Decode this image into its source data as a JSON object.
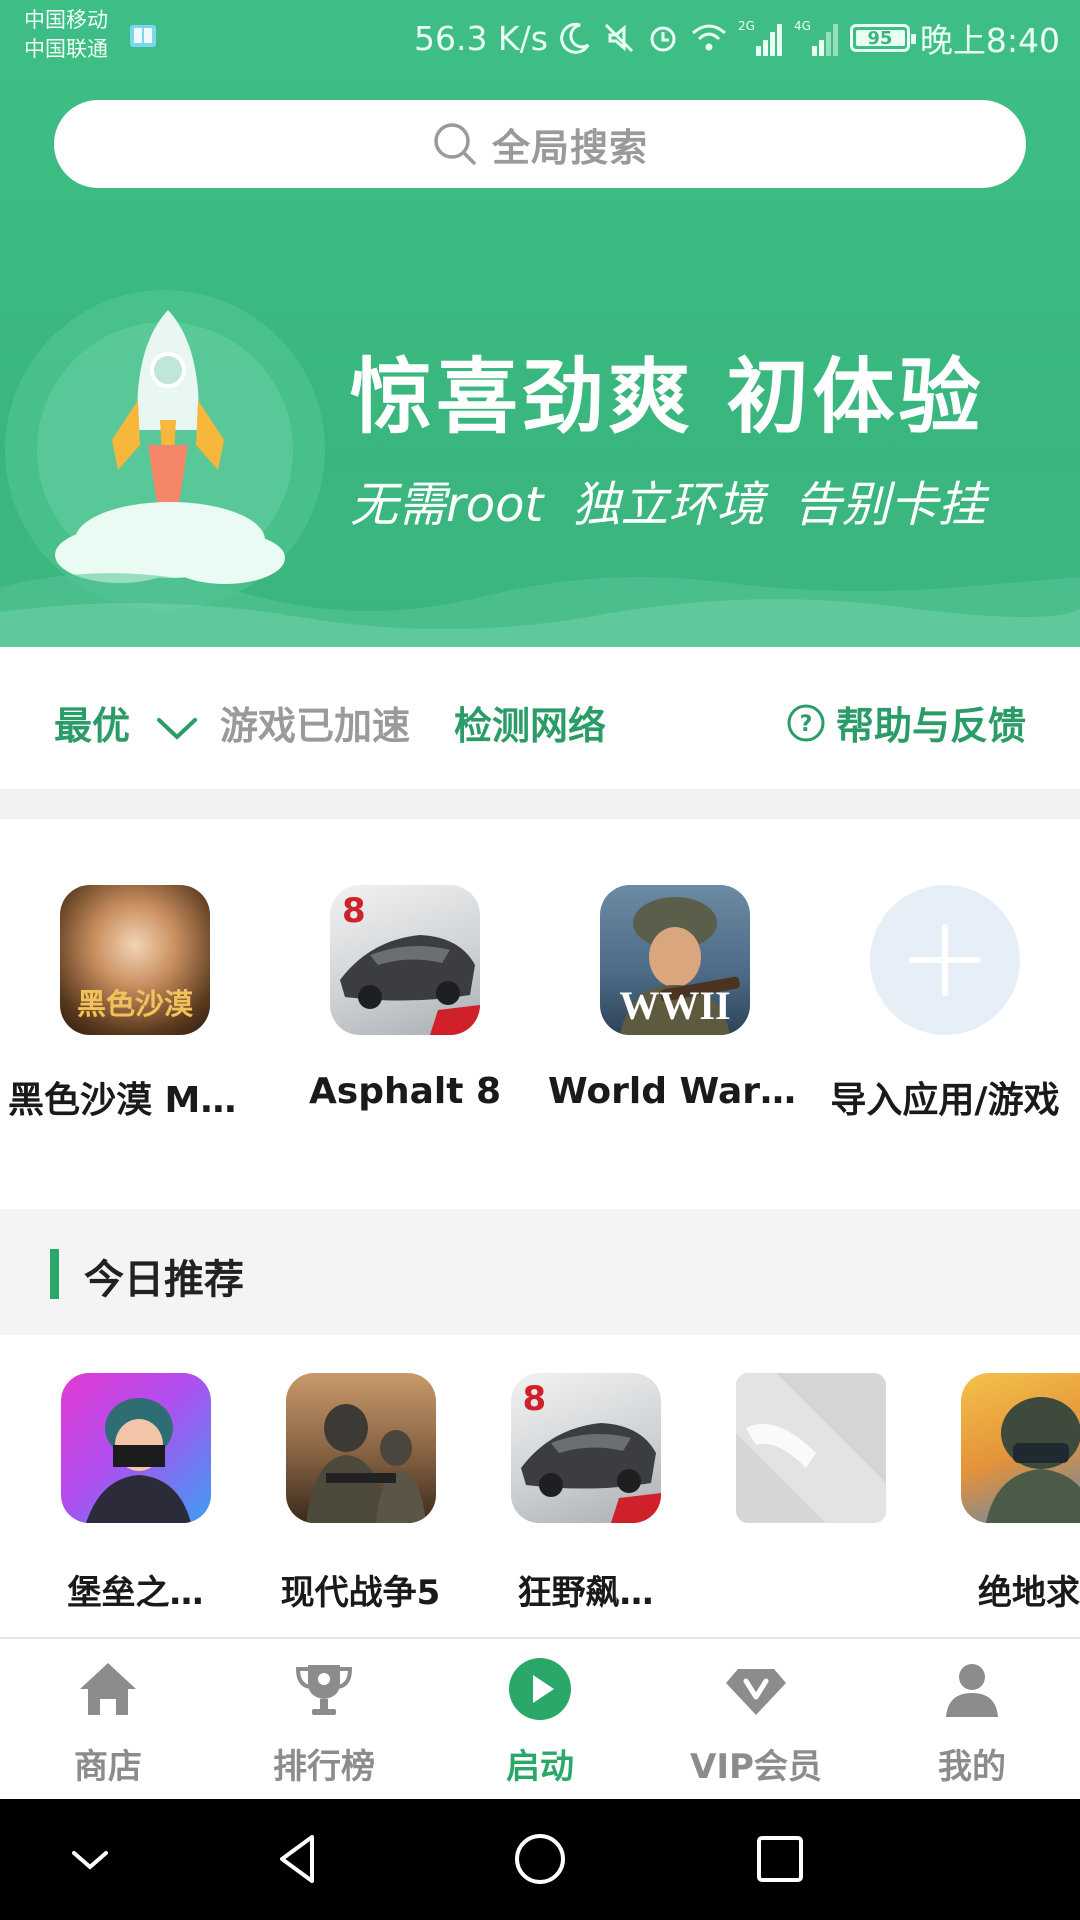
{
  "status_bar": {
    "carrier1": "中国移动",
    "carrier2": "中国联通",
    "speed": "56.3 K/s",
    "net1": "2G",
    "net2": "4G",
    "battery": "95",
    "time": "晚上8:40"
  },
  "search": {
    "placeholder": "全局搜索"
  },
  "banner": {
    "title": "惊喜劲爽  初体验",
    "subtitle": "无需root  独立环境  告别卡挂"
  },
  "accelerate": {
    "mode": "最优",
    "status": "游戏已加速",
    "detect": "检测网络",
    "help": "帮助与反馈"
  },
  "my_games": [
    {
      "name": "黑色沙漠 MO…",
      "icon_text": "黑色沙漠"
    },
    {
      "name": "Asphalt 8",
      "icon_text": "8"
    },
    {
      "name": "World War …",
      "icon_text": "WWII"
    },
    {
      "name": "导入应用/游戏"
    }
  ],
  "recommend": {
    "title": "今日推荐",
    "items": [
      {
        "name": "堡垒之…"
      },
      {
        "name": "现代战争5"
      },
      {
        "name": "狂野飙…"
      },
      {
        "name": ""
      },
      {
        "name": "绝地求·"
      }
    ]
  },
  "nav": {
    "items": [
      {
        "label": "商店",
        "icon": "home-icon"
      },
      {
        "label": "排行榜",
        "icon": "trophy-icon"
      },
      {
        "label": "启动",
        "icon": "play-icon"
      },
      {
        "label": "VIP会员",
        "icon": "vip-diamond-icon"
      },
      {
        "label": "我的",
        "icon": "user-icon"
      }
    ],
    "active": "启动"
  },
  "colors": {
    "brand": "#3ab57d",
    "accent_text": "#2b9c68",
    "muted": "#9a9a9a"
  }
}
